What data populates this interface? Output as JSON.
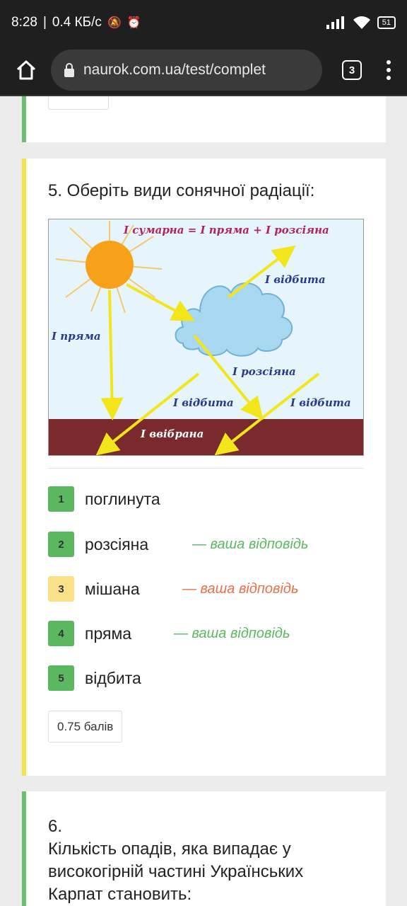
{
  "status_bar": {
    "time": "8:28",
    "speed": "0.4 КБ/с",
    "battery": "51"
  },
  "browser": {
    "url": "naurok.com.ua/test/complet",
    "tab_count": "3"
  },
  "question5": {
    "title": "5. Оберіть види сонячної радіації:",
    "figure_labels": {
      "formula": "І сумарна = І пряма + І розсіяна",
      "direct": "І пряма",
      "reflected_cloud": "І відбита",
      "scattered": "І розсіяна",
      "reflected_ground1": "І відбита",
      "reflected_ground2": "І відбита",
      "absorbed": "І ввібрана"
    },
    "options": [
      {
        "num": "1",
        "label": "поглинута",
        "note": "",
        "state": "ok"
      },
      {
        "num": "2",
        "label": "розсіяна",
        "note": "— ваша відповідь",
        "state": "ok"
      },
      {
        "num": "3",
        "label": "мішана",
        "note": "— ваша відповідь",
        "state": "warn"
      },
      {
        "num": "4",
        "label": "пряма",
        "note": "— ваша відповідь",
        "state": "ok"
      },
      {
        "num": "5",
        "label": "відбита",
        "note": "",
        "state": "ok"
      }
    ],
    "score": "0.75 балів"
  },
  "question6": {
    "number": "6.",
    "text": "Кількість опадів, яка випадає у високогірній частині Українських Карпат становить:"
  },
  "colors": {
    "correct": "#5cb860",
    "partial": "#f6e24a",
    "wrong_note": "#e8704a",
    "ground": "#7a2a2c",
    "sky": "#e6f4fb",
    "cloud": "#a8d8f0",
    "sun": "#f7a11a",
    "arrow": "#f2e61a",
    "label": "#2a3a8a",
    "formula": "#b0245a"
  }
}
